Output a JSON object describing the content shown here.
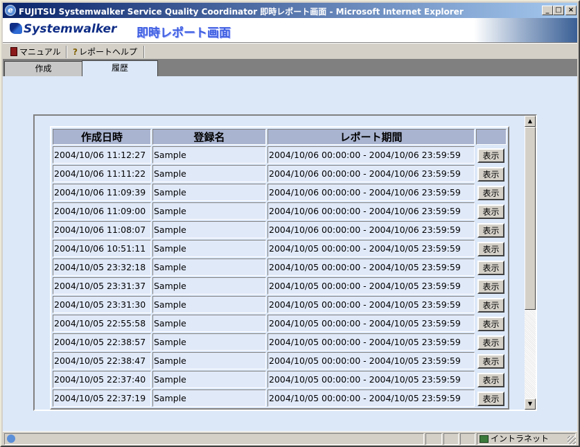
{
  "window": {
    "title": "FUJITSU Systemwalker Service Quality Coordinator 即時レポート画面 - Microsoft Internet Explorer",
    "minimize": "_",
    "maximize": "□",
    "close": "×"
  },
  "banner": {
    "logo": "Systemwalker",
    "title": "即時レポート画面"
  },
  "toolbar": {
    "manual_label": "マニュアル",
    "help_label": "レポートヘルプ"
  },
  "tabs": [
    {
      "label": "作成",
      "active": false
    },
    {
      "label": "履歴",
      "active": true
    }
  ],
  "table": {
    "headers": [
      "作成日時",
      "登録名",
      "レポート期間",
      ""
    ],
    "button_label": "表示",
    "rows": [
      {
        "created": "2004/10/06 11:12:27",
        "name": "Sample",
        "period": "2004/10/06 00:00:00 - 2004/10/06 23:59:59"
      },
      {
        "created": "2004/10/06 11:11:22",
        "name": "Sample",
        "period": "2004/10/06 00:00:00 - 2004/10/06 23:59:59"
      },
      {
        "created": "2004/10/06 11:09:39",
        "name": "Sample",
        "period": "2004/10/06 00:00:00 - 2004/10/06 23:59:59"
      },
      {
        "created": "2004/10/06 11:09:00",
        "name": "Sample",
        "period": "2004/10/06 00:00:00 - 2004/10/06 23:59:59"
      },
      {
        "created": "2004/10/06 11:08:07",
        "name": "Sample",
        "period": "2004/10/06 00:00:00 - 2004/10/06 23:59:59"
      },
      {
        "created": "2004/10/06 10:51:11",
        "name": "Sample",
        "period": "2004/10/05 00:00:00 - 2004/10/05 23:59:59"
      },
      {
        "created": "2004/10/05 23:32:18",
        "name": "Sample",
        "period": "2004/10/05 00:00:00 - 2004/10/05 23:59:59"
      },
      {
        "created": "2004/10/05 23:31:37",
        "name": "Sample",
        "period": "2004/10/05 00:00:00 - 2004/10/05 23:59:59"
      },
      {
        "created": "2004/10/05 23:31:30",
        "name": "Sample",
        "period": "2004/10/05 00:00:00 - 2004/10/05 23:59:59"
      },
      {
        "created": "2004/10/05 22:55:58",
        "name": "Sample",
        "period": "2004/10/05 00:00:00 - 2004/10/05 23:59:59"
      },
      {
        "created": "2004/10/05 22:38:57",
        "name": "Sample",
        "period": "2004/10/05 00:00:00 - 2004/10/05 23:59:59"
      },
      {
        "created": "2004/10/05 22:38:47",
        "name": "Sample",
        "period": "2004/10/05 00:00:00 - 2004/10/05 23:59:59"
      },
      {
        "created": "2004/10/05 22:37:40",
        "name": "Sample",
        "period": "2004/10/05 00:00:00 - 2004/10/05 23:59:59"
      },
      {
        "created": "2004/10/05 22:37:19",
        "name": "Sample",
        "period": "2004/10/05 00:00:00 - 2004/10/05 23:59:59"
      }
    ]
  },
  "statusbar": {
    "zone": "イントラネット"
  }
}
